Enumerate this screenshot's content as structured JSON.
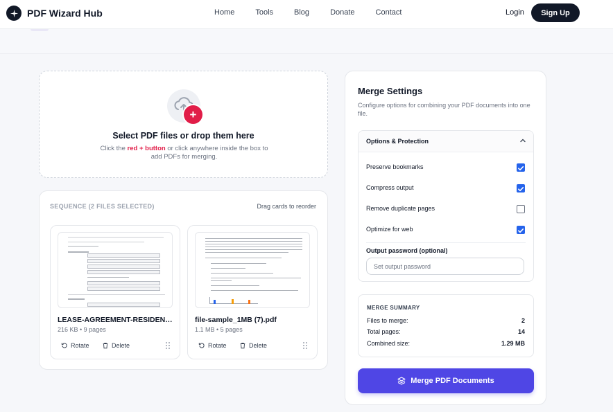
{
  "header": {
    "brand": "PDF Wizard Hub",
    "nav": [
      "Home",
      "Tools",
      "Blog",
      "Donate",
      "Contact"
    ],
    "login": "Login",
    "signup": "Sign Up"
  },
  "dropzone": {
    "title": "Select PDF files or drop them here",
    "sub_before": "Click the ",
    "sub_red": "red + button",
    "sub_after": " or click anywhere inside the box to add PDFs for merging.",
    "plus": "+"
  },
  "sequence": {
    "title": "SEQUENCE (2 FILES SELECTED)",
    "hint": "Drag cards to reorder",
    "files": [
      {
        "name": "LEASE-AGREEMENT-RESIDEN…",
        "meta": "216 KB • 9 pages",
        "rotate": "Rotate",
        "delete": "Delete"
      },
      {
        "name": "file-sample_1MB (7).pdf",
        "meta": "1.1 MB • 5 pages",
        "rotate": "Rotate",
        "delete": "Delete"
      }
    ]
  },
  "settings": {
    "title": "Merge Settings",
    "desc": "Configure options for combining your PDF documents into one file.",
    "section": "Options & Protection",
    "options": [
      {
        "label": "Preserve bookmarks",
        "checked": true
      },
      {
        "label": "Compress output",
        "checked": true
      },
      {
        "label": "Remove duplicate pages",
        "checked": false
      },
      {
        "label": "Optimize for web",
        "checked": true
      }
    ],
    "password_label": "Output password (optional)",
    "password_placeholder": "Set output password",
    "password_value": ""
  },
  "summary": {
    "title": "MERGE SUMMARY",
    "rows": [
      {
        "label": "Files to merge:",
        "value": "2"
      },
      {
        "label": "Total pages:",
        "value": "14"
      },
      {
        "label": "Combined size:",
        "value": "1.29 MB"
      }
    ]
  },
  "merge_button": "Merge PDF Documents",
  "colors": {
    "accent": "#4f46e5",
    "danger": "#e11d48",
    "check": "#2563eb",
    "dark": "#111827"
  }
}
